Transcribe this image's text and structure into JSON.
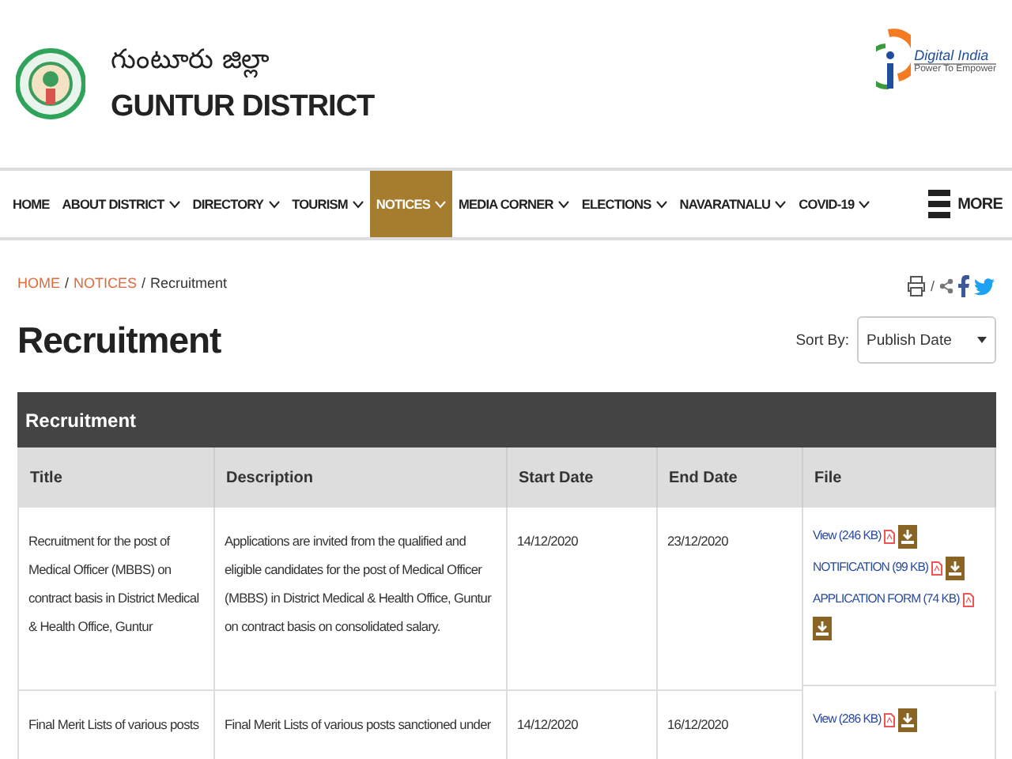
{
  "header": {
    "title_telugu": "గుంటూరు జిల్లా",
    "title": "GUNTUR DISTRICT",
    "brand_title": "Digital India",
    "brand_tagline": "Power To Empower"
  },
  "nav": {
    "items": [
      {
        "label": "HOME",
        "dropdown": false,
        "selected": false
      },
      {
        "label": "ABOUT DISTRICT",
        "dropdown": true,
        "selected": false
      },
      {
        "label": "DIRECTORY",
        "dropdown": true,
        "selected": false
      },
      {
        "label": "TOURISM",
        "dropdown": true,
        "selected": false
      },
      {
        "label": "NOTICES",
        "dropdown": true,
        "selected": true
      },
      {
        "label": "MEDIA CORNER",
        "dropdown": true,
        "selected": false
      },
      {
        "label": "ELECTIONS",
        "dropdown": true,
        "selected": false
      },
      {
        "label": "NAVARATNALU",
        "dropdown": true,
        "selected": false
      },
      {
        "label": "COVID-19",
        "dropdown": true,
        "selected": false
      }
    ],
    "more": "MORE"
  },
  "breadcrumb": {
    "links": [
      "HOME",
      "NOTICES"
    ],
    "current": "Recruitment",
    "separator": "/"
  },
  "share": {
    "separator": "/"
  },
  "page_title": "Recruitment",
  "sort": {
    "label": "Sort By:",
    "value": "Publish Date"
  },
  "table": {
    "caption": "Recruitment",
    "columns": [
      "Title",
      "Description",
      "Start Date",
      "End Date",
      "File"
    ],
    "rows": [
      {
        "title": "Recruitment for the post of Medical Officer (MBBS) on contract basis in District Medical & Health Office, Guntur",
        "description": "Applications are invited from the qualified and eligible candidates for the post of Medical Officer (MBBS) in District Medical & Health Office, Guntur on contract basis on consolidated salary.",
        "start": "14/12/2020",
        "end": "23/12/2020",
        "files": [
          "View (246 KB)",
          "NOTIFICATION (99 KB)",
          "APPLICATION FORM (74 KB)"
        ]
      },
      {
        "title": "Final Merit Lists of various posts",
        "description": "Final Merit Lists of various posts sanctioned under",
        "start": "14/12/2020",
        "end": "16/12/2020",
        "files": [
          "View (286 KB)"
        ]
      }
    ]
  }
}
